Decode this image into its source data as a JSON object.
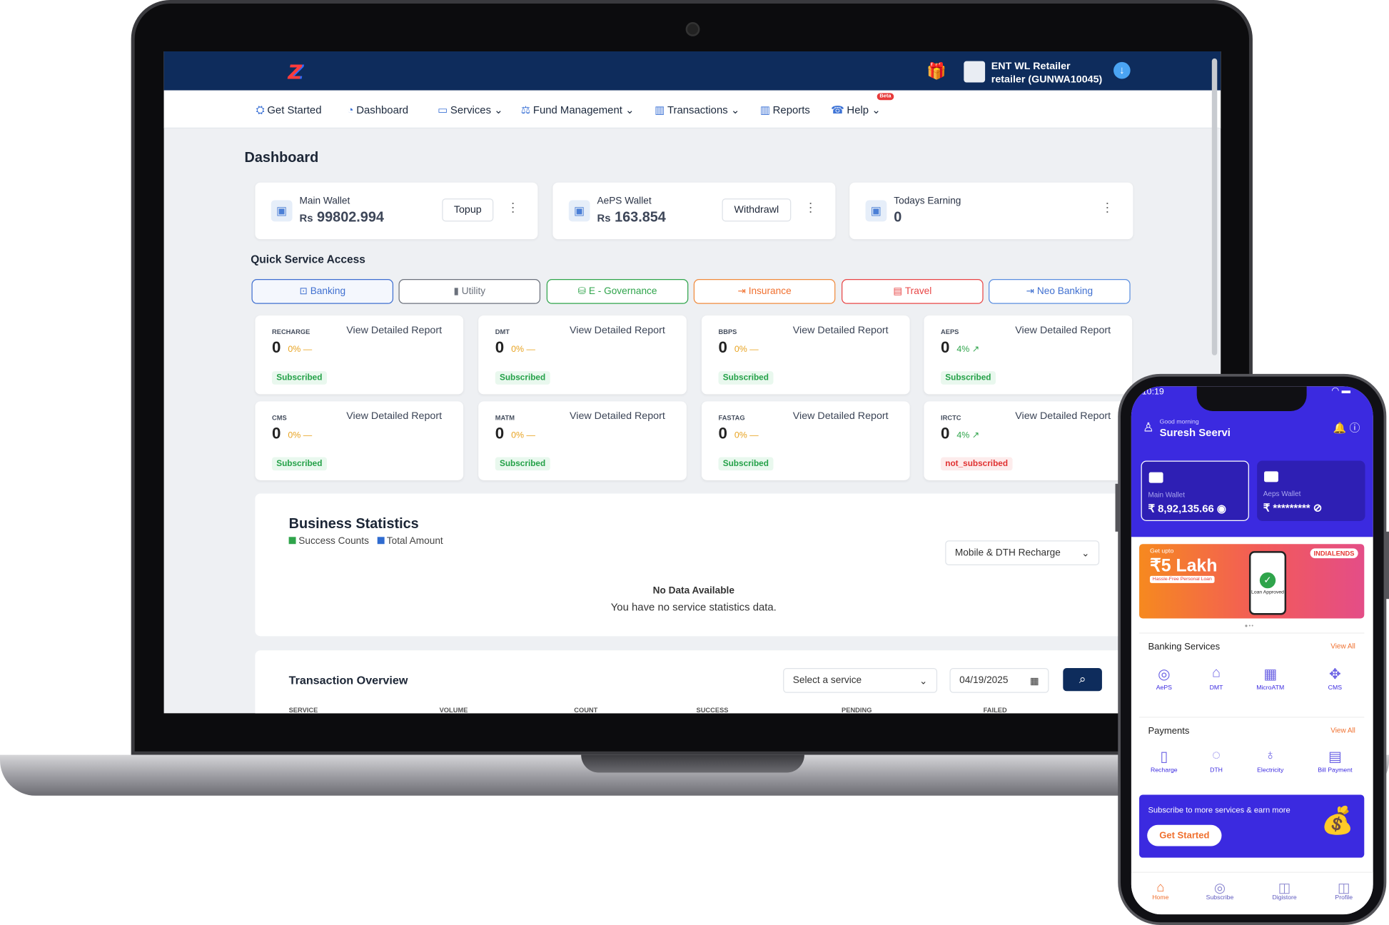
{
  "header": {
    "user_line1": "ENT WL Retailer",
    "user_line2": "retailer (GUNWA10045)"
  },
  "nav": {
    "items": [
      "Get Started",
      "Dashboard",
      "Services",
      "Fund Management",
      "Transactions",
      "Reports",
      "Help"
    ],
    "beta": "Beta"
  },
  "page_title": "Dashboard",
  "wallets": [
    {
      "label": "Main Wallet",
      "currency": "Rs",
      "value": "99802.994",
      "button": "Topup"
    },
    {
      "label": "AePS Wallet",
      "currency": "Rs",
      "value": "163.854",
      "button": "Withdrawl"
    },
    {
      "label": "Todays Earning",
      "value": "0"
    }
  ],
  "quick_access": {
    "title": "Quick Service Access",
    "tabs": [
      "Banking",
      "Utility",
      "E - Governance",
      "Insurance",
      "Travel",
      "Neo Banking"
    ]
  },
  "services": [
    {
      "name": "RECHARGE",
      "value": "0",
      "pct": "0%",
      "trend": "—",
      "link": "View Detailed Report",
      "status": "Subscribed"
    },
    {
      "name": "DMT",
      "value": "0",
      "pct": "0%",
      "trend": "—",
      "link": "View Detailed Report",
      "status": "Subscribed"
    },
    {
      "name": "BBPS",
      "value": "0",
      "pct": "0%",
      "trend": "—",
      "link": "View Detailed Report",
      "status": "Subscribed"
    },
    {
      "name": "AEPS",
      "value": "0",
      "pct": "4%",
      "trend": "↗",
      "link": "View Detailed Report",
      "status": "Subscribed"
    },
    {
      "name": "CMS",
      "value": "0",
      "pct": "0%",
      "trend": "—",
      "link": "View Detailed Report",
      "status": "Subscribed"
    },
    {
      "name": "MATM",
      "value": "0",
      "pct": "0%",
      "trend": "—",
      "link": "View Detailed Report",
      "status": "Subscribed"
    },
    {
      "name": "FASTAG",
      "value": "0",
      "pct": "0%",
      "trend": "—",
      "link": "View Detailed Report",
      "status": "Subscribed"
    },
    {
      "name": "IRCTC",
      "value": "0",
      "pct": "4%",
      "trend": "↗",
      "link": "View Detailed Report",
      "status": "not_subscribed"
    }
  ],
  "business_stats": {
    "title": "Business Statistics",
    "legend_success": "Success Counts",
    "legend_total": "Total Amount",
    "select": "Mobile & DTH Recharge",
    "no_data": "No Data Available",
    "no_data_sub": "You have no service statistics data."
  },
  "transaction_overview": {
    "title": "Transaction Overview",
    "select_placeholder": "Select a service",
    "date": "04/19/2025",
    "columns": [
      "SERVICE",
      "VOLUME",
      "COUNT",
      "SUCCESS",
      "PENDING",
      "FAILED"
    ]
  },
  "phone": {
    "time": "10:19",
    "greeting": "Good morning",
    "name": "Suresh Seervi",
    "main_wallet_label": "Main Wallet",
    "main_wallet_value": "₹ 8,92,135.66",
    "aeps_wallet_label": "Aeps Wallet",
    "aeps_wallet_value": "₹ *********",
    "banner_line1": "Get upto",
    "banner_line2": "₹5 Lakh",
    "banner_line3": "Hassle-Free Personal Loan",
    "banner_brand": "INDIALENDS",
    "banner_phone_text": "Loan Approved",
    "banking_title": "Banking Services",
    "view_all": "View All",
    "banking_items": [
      "AePS",
      "DMT",
      "MicroATM",
      "CMS"
    ],
    "payments_title": "Payments",
    "payment_items": [
      "Recharge",
      "DTH",
      "Electricity",
      "Bill Payment"
    ],
    "subscribe_text": "Subscribe to more services & earn more",
    "subscribe_button": "Get Started",
    "bottom_tabs": [
      "Home",
      "Subscribe",
      "Digistore",
      "Profile"
    ]
  },
  "colors": {
    "navy": "#0e2c5c",
    "purple": "#3b2ae0",
    "orange": "#f0702f",
    "green": "#24a148"
  }
}
